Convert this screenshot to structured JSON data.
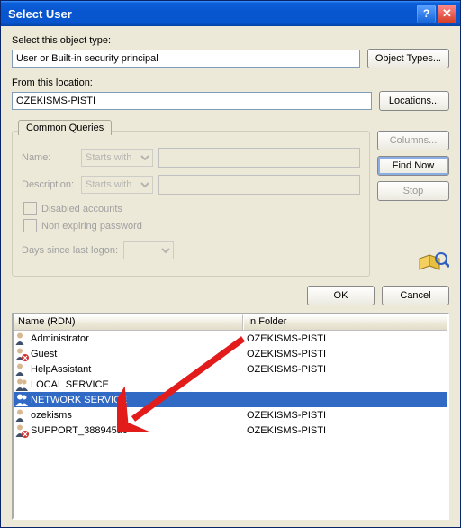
{
  "title": "Select User",
  "labels": {
    "objectType": "Select this object type:",
    "location": "From this location:",
    "commonQueries": "Common Queries",
    "name": "Name:",
    "description": "Description:",
    "disabled": "Disabled accounts",
    "nonExpiring": "Non expiring password",
    "daysSince": "Days since last logon:"
  },
  "values": {
    "objectType": "User or Built-in security principal",
    "location": "OZEKISMS-PISTI",
    "nameMode": "Starts with",
    "descMode": "Starts with"
  },
  "buttons": {
    "objectTypes": "Object Types...",
    "locations": "Locations...",
    "columns": "Columns...",
    "findNow": "Find Now",
    "stop": "Stop",
    "ok": "OK",
    "cancel": "Cancel"
  },
  "results": {
    "headers": {
      "name": "Name (RDN)",
      "folder": "In Folder"
    },
    "rows": [
      {
        "name": "Administrator",
        "folder": "OZEKISMS-PISTI",
        "icon": "user",
        "selected": false
      },
      {
        "name": "Guest",
        "folder": "OZEKISMS-PISTI",
        "icon": "user-x",
        "selected": false
      },
      {
        "name": "HelpAssistant",
        "folder": "OZEKISMS-PISTI",
        "icon": "user",
        "selected": false
      },
      {
        "name": "LOCAL SERVICE",
        "folder": "",
        "icon": "group",
        "selected": false
      },
      {
        "name": "NETWORK SERVICE",
        "folder": "",
        "icon": "group",
        "selected": true
      },
      {
        "name": "ozekisms",
        "folder": "OZEKISMS-PISTI",
        "icon": "user",
        "selected": false
      },
      {
        "name": "SUPPORT_388945a0",
        "folder": "OZEKISMS-PISTI",
        "icon": "user-x",
        "selected": false
      }
    ]
  }
}
